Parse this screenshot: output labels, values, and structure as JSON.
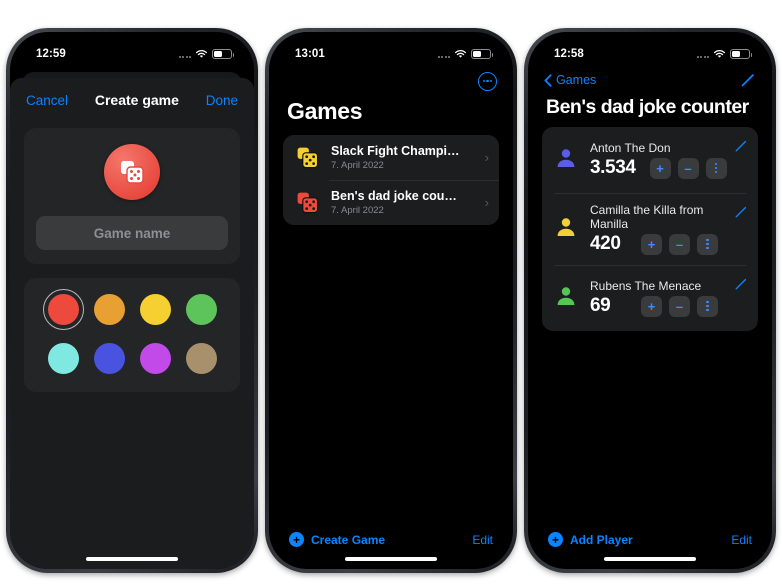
{
  "phones": [
    {
      "id": "create-game",
      "status": {
        "time": "12:59",
        "wifi": "wifi-icon",
        "battery": "battery-icon",
        "signal": "signal-icon"
      },
      "nav": {
        "cancel": "Cancel",
        "title": "Create game",
        "done": "Done"
      },
      "icon": {
        "name": "dice-icon",
        "color": "#e8493f"
      },
      "input": {
        "placeholder": "Game name",
        "value": ""
      },
      "swatches": [
        {
          "name": "red",
          "hex": "#ed4a3d",
          "selected": true
        },
        {
          "name": "orange",
          "hex": "#e8a033",
          "selected": false
        },
        {
          "name": "yellow",
          "hex": "#f5d030",
          "selected": false
        },
        {
          "name": "green",
          "hex": "#5cc45a",
          "selected": false
        },
        {
          "name": "cyan",
          "hex": "#7fe8e0",
          "selected": false
        },
        {
          "name": "blue",
          "hex": "#4a53e0",
          "selected": false
        },
        {
          "name": "purple",
          "hex": "#c24ae8",
          "selected": false
        },
        {
          "name": "tan",
          "hex": "#a8906c",
          "selected": false
        }
      ]
    },
    {
      "id": "games-list",
      "status": {
        "time": "13:01"
      },
      "more_button": "more-ellipsis-icon",
      "title": "Games",
      "rows": [
        {
          "title": "Slack Fight Champi…",
          "subtitle": "7. April 2022",
          "icon_color": "#f5d030"
        },
        {
          "title": "Ben's dad joke cou…",
          "subtitle": "7. April 2022",
          "icon_color": "#ed4a3d"
        }
      ],
      "bottom": {
        "action": "Create Game",
        "edit": "Edit"
      }
    },
    {
      "id": "game-detail",
      "status": {
        "time": "12:58"
      },
      "back": "Games",
      "edit_icon": "pencil-icon",
      "title": "Ben's dad joke counter",
      "players": [
        {
          "name": "Anton The Don",
          "score": "3.534",
          "avatar_color": "#5b5bec"
        },
        {
          "name": "Camilla the Killa from Manilla",
          "score": "420",
          "avatar_color": "#f2d03a"
        },
        {
          "name": "Rubens The Menace",
          "score": "69",
          "avatar_color": "#55c553"
        }
      ],
      "buttons": {
        "increment": "+",
        "decrement": "–",
        "menu": "more-vertical-icon"
      },
      "bottom": {
        "action": "Add Player",
        "edit": "Edit"
      }
    }
  ]
}
